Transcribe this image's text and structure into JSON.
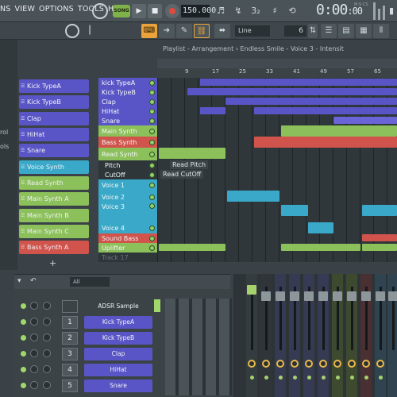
{
  "menu": [
    "NS",
    "VIEW",
    "OPTIONS",
    "TOOLS",
    "HELP"
  ],
  "toolbar": {
    "song_label": "SONG",
    "play": "▶",
    "stop": "■",
    "tempo": "150.000",
    "time": "0:00",
    "time_sub": ":00",
    "time_label": "M:S:CS"
  },
  "toolbar2": {
    "snap": "Line",
    "snap_value": "6"
  },
  "browser": {
    "item1": "rol",
    "item2": "ols"
  },
  "patterns": [
    {
      "label": "Kick TypeA",
      "color": "#5a55c7"
    },
    {
      "label": "Kick TypeB",
      "color": "#5a55c7"
    },
    {
      "label": "Clap",
      "color": "#5a55c7"
    },
    {
      "label": "HiHat",
      "color": "#5a55c7"
    },
    {
      "label": "Snare",
      "color": "#5a55c7"
    },
    {
      "label": "Voice Synth",
      "color": "#3aa9c9"
    },
    {
      "label": "Read Synth",
      "color": "#8cc05a"
    },
    {
      "label": "Main Synth A",
      "color": "#8cc05a"
    },
    {
      "label": "Main Synth B",
      "color": "#8cc05a"
    },
    {
      "label": "Main Synth C",
      "color": "#8cc05a"
    },
    {
      "label": "Bass Synth A",
      "color": "#d0534c"
    }
  ],
  "playlist": {
    "title": "Playlist - Arrangement › Endless Smile - Voice 3 - Intensit",
    "ruler": [
      "9",
      "17",
      "25",
      "33",
      "41",
      "49",
      "57",
      "65"
    ],
    "tracks": [
      {
        "label": "kick TypeA",
        "color": "#5a55c7"
      },
      {
        "label": "Kick TypeB",
        "color": "#5a55c7"
      },
      {
        "label": "Clap",
        "color": "#5a55c7"
      },
      {
        "label": "HiHat",
        "color": "#5a55c7"
      },
      {
        "label": "Snare",
        "color": "#5a55c7"
      },
      {
        "label": "Main Synth",
        "color": "#8cc05a"
      },
      {
        "label": "Bass Synth",
        "color": "#d0534c"
      },
      {
        "label": "Read Synth",
        "color": "#8cc05a"
      },
      {
        "label": "Pitch",
        "color": "#2f363a"
      },
      {
        "label": "CutOff",
        "color": "#2f363a"
      },
      {
        "label": "Voice 1",
        "color": "#3aa9c9"
      },
      {
        "label": "Voice 2",
        "color": "#3aa9c9"
      },
      {
        "label": "Voice 3",
        "color": "#3aa9c9"
      },
      {
        "label": "Voice 4",
        "color": "#3aa9c9"
      },
      {
        "label": "Sound Bass",
        "color": "#d0534c"
      },
      {
        "label": "Uplifter",
        "color": "#8cc05a"
      },
      {
        "label": "Track 17",
        "color": "#2f363a"
      }
    ],
    "automation": [
      "Read Pitch",
      "Read CutOff"
    ]
  },
  "rack": {
    "filter": "All",
    "channels": [
      {
        "num": "",
        "label": "ADSR Sample Manager",
        "color": "#3b4347"
      },
      {
        "num": "1",
        "label": "Kick TypeA",
        "color": "#5a55c7"
      },
      {
        "num": "2",
        "label": "Kick TypeB",
        "color": "#5a55c7"
      },
      {
        "num": "3",
        "label": "Clap",
        "color": "#5a55c7"
      },
      {
        "num": "4",
        "label": "HiHat",
        "color": "#5a55c7"
      },
      {
        "num": "5",
        "label": "Snare",
        "color": "#5a55c7"
      }
    ]
  }
}
